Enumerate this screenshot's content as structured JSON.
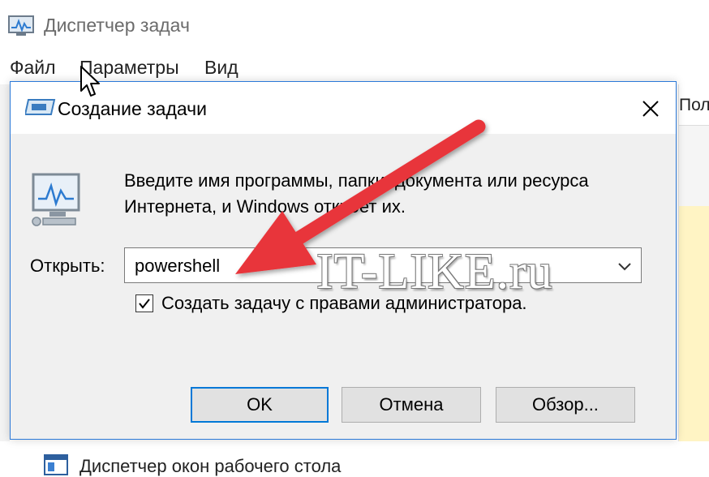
{
  "task_manager": {
    "title": "Диспетчер задач",
    "menu": [
      "Файл",
      "Параметры",
      "Вид"
    ],
    "column_header_partial": "Пол",
    "bottom_row_text": "Диспетчер окон рабочего стола"
  },
  "dialog": {
    "title": "Создание задачи",
    "description_line1": "Введите имя программы, папки, документа или ресурса",
    "description_line2": "Интернета, и Windows откроет их.",
    "open_label": "Открыть:",
    "open_value": "powershell",
    "admin_checkbox_label": "Создать задачу с правами администратора.",
    "admin_checked": true,
    "buttons": {
      "ok": "OK",
      "cancel": "Отмена",
      "browse": "Обзор..."
    }
  },
  "watermark": "IT-LIKE.ru",
  "colors": {
    "accent_blue": "#0078d7",
    "annotation_arrow": "#e8353a",
    "dialog_bg": "#f0f0f0"
  }
}
